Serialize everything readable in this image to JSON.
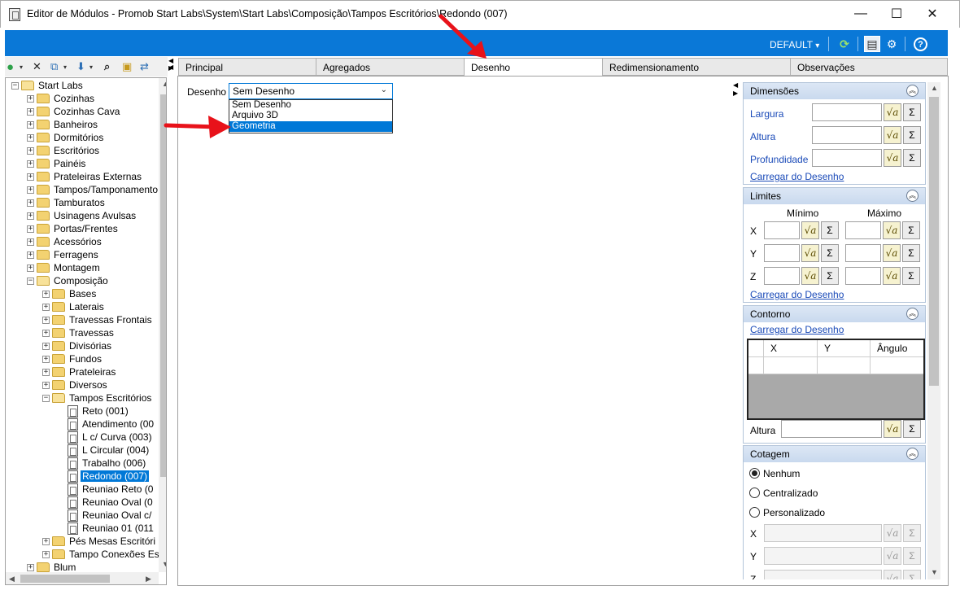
{
  "window": {
    "title": "Editor de Módulos - Promob Start Labs\\System\\Start Labs\\Composição\\Tampos Escritórios\\Redondo (007)",
    "minimize_glyph": "—",
    "maximize_glyph": "☐",
    "close_glyph": "✕"
  },
  "toolbar": {
    "profile_label": "DEFAULT",
    "profile_arrow": "▾",
    "refresh_glyph": "⟳",
    "panel_glyph": "▤",
    "settings_glyph": "⚙",
    "help_glyph": "?"
  },
  "tree_toolbar": {
    "add_glyph": "●",
    "delete_glyph": "✕",
    "copy_glyph": "⧉",
    "move_glyph": "⬇",
    "find_glyph": "⌕",
    "folder_glyph": "▣",
    "sync_glyph": "⇄"
  },
  "tree": {
    "items": [
      {
        "label": "Start Labs",
        "level": 0,
        "kind": "folder-open",
        "exp": "−"
      },
      {
        "label": "Cozinhas",
        "level": 1,
        "kind": "folder",
        "exp": "+"
      },
      {
        "label": "Cozinhas Cava",
        "level": 1,
        "kind": "folder",
        "exp": "+"
      },
      {
        "label": "Banheiros",
        "level": 1,
        "kind": "folder",
        "exp": "+"
      },
      {
        "label": "Dormitórios",
        "level": 1,
        "kind": "folder",
        "exp": "+"
      },
      {
        "label": "Escritórios",
        "level": 1,
        "kind": "folder",
        "exp": "+"
      },
      {
        "label": "Painéis",
        "level": 1,
        "kind": "folder",
        "exp": "+"
      },
      {
        "label": "Prateleiras Externas",
        "level": 1,
        "kind": "folder",
        "exp": "+"
      },
      {
        "label": "Tampos/Tamponamento",
        "level": 1,
        "kind": "folder",
        "exp": "+"
      },
      {
        "label": "Tamburatos",
        "level": 1,
        "kind": "folder",
        "exp": "+"
      },
      {
        "label": "Usinagens Avulsas",
        "level": 1,
        "kind": "folder",
        "exp": "+"
      },
      {
        "label": "Portas/Frentes",
        "level": 1,
        "kind": "folder",
        "exp": "+"
      },
      {
        "label": "Acessórios",
        "level": 1,
        "kind": "folder",
        "exp": "+"
      },
      {
        "label": "Ferragens",
        "level": 1,
        "kind": "folder",
        "exp": "+"
      },
      {
        "label": "Montagem",
        "level": 1,
        "kind": "folder",
        "exp": "+"
      },
      {
        "label": "Composição",
        "level": 1,
        "kind": "folder-open",
        "exp": "−"
      },
      {
        "label": "Bases",
        "level": 2,
        "kind": "folder",
        "exp": "+"
      },
      {
        "label": "Laterais",
        "level": 2,
        "kind": "folder",
        "exp": "+"
      },
      {
        "label": "Travessas Frontais",
        "level": 2,
        "kind": "folder",
        "exp": "+"
      },
      {
        "label": "Travessas",
        "level": 2,
        "kind": "folder",
        "exp": "+"
      },
      {
        "label": "Divisórias",
        "level": 2,
        "kind": "folder",
        "exp": "+"
      },
      {
        "label": "Fundos",
        "level": 2,
        "kind": "folder",
        "exp": "+"
      },
      {
        "label": "Prateleiras",
        "level": 2,
        "kind": "folder",
        "exp": "+"
      },
      {
        "label": "Diversos",
        "level": 2,
        "kind": "folder",
        "exp": "+"
      },
      {
        "label": "Tampos Escritórios",
        "level": 2,
        "kind": "folder-open",
        "exp": "−"
      },
      {
        "label": "Reto (001)",
        "level": 3,
        "kind": "doc",
        "exp": ""
      },
      {
        "label": "Atendimento (00",
        "level": 3,
        "kind": "doc",
        "exp": ""
      },
      {
        "label": "L c/ Curva (003)",
        "level": 3,
        "kind": "doc",
        "exp": ""
      },
      {
        "label": "L Circular (004)",
        "level": 3,
        "kind": "doc",
        "exp": ""
      },
      {
        "label": "Trabalho (006)",
        "level": 3,
        "kind": "doc",
        "exp": ""
      },
      {
        "label": "Redondo (007)",
        "level": 3,
        "kind": "doc",
        "exp": "",
        "selected": true
      },
      {
        "label": "Reuniao Reto (0",
        "level": 3,
        "kind": "doc",
        "exp": ""
      },
      {
        "label": "Reuniao Oval (0",
        "level": 3,
        "kind": "doc",
        "exp": ""
      },
      {
        "label": "Reuniao Oval c/",
        "level": 3,
        "kind": "doc",
        "exp": ""
      },
      {
        "label": "Reuniao 01 (011",
        "level": 3,
        "kind": "doc",
        "exp": ""
      },
      {
        "label": "Pés Mesas Escritóri",
        "level": 2,
        "kind": "folder",
        "exp": "+"
      },
      {
        "label": "Tampo Conexões Es",
        "level": 2,
        "kind": "folder",
        "exp": "+"
      },
      {
        "label": "Blum",
        "level": 1,
        "kind": "folder",
        "exp": "+"
      }
    ]
  },
  "tabs": [
    {
      "label": "Principal"
    },
    {
      "label": "Agregados"
    },
    {
      "label": "Desenho",
      "active": true
    },
    {
      "label": "Redimensionamento"
    },
    {
      "label": "Observações"
    }
  ],
  "desenho": {
    "label": "Desenho",
    "selected": "Sem Desenho",
    "options": [
      "Sem Desenho",
      "Arquivo 3D",
      "Geometria"
    ],
    "highlighted_index": 2
  },
  "dimensoes": {
    "title": "Dimensões",
    "fields": [
      "Largura",
      "Altura",
      "Profundidade"
    ],
    "load_link": "Carregar do Desenho"
  },
  "limites": {
    "title": "Limites",
    "min_label": "Mínimo",
    "max_label": "Máximo",
    "axes": [
      "X",
      "Y",
      "Z"
    ],
    "load_link": "Carregar do Desenho"
  },
  "contorno": {
    "title": "Contorno",
    "load_link": "Carregar do Desenho",
    "columns": [
      "X",
      "Y",
      "Ângulo"
    ],
    "altura_label": "Altura"
  },
  "cotagem": {
    "title": "Cotagem",
    "options": [
      {
        "label": "Nenhum",
        "checked": true
      },
      {
        "label": "Centralizado",
        "checked": false
      },
      {
        "label": "Personalizado",
        "checked": false
      }
    ],
    "axes": [
      "X",
      "Y",
      "Z"
    ]
  },
  "glyphs": {
    "sqrt": "√a",
    "sigma": "Σ",
    "collapse": "︽"
  },
  "colors": {
    "accent": "#0a78d7",
    "selection": "#0078d7",
    "link": "#1a4ab8",
    "annotation_arrow": "#e8121a"
  }
}
